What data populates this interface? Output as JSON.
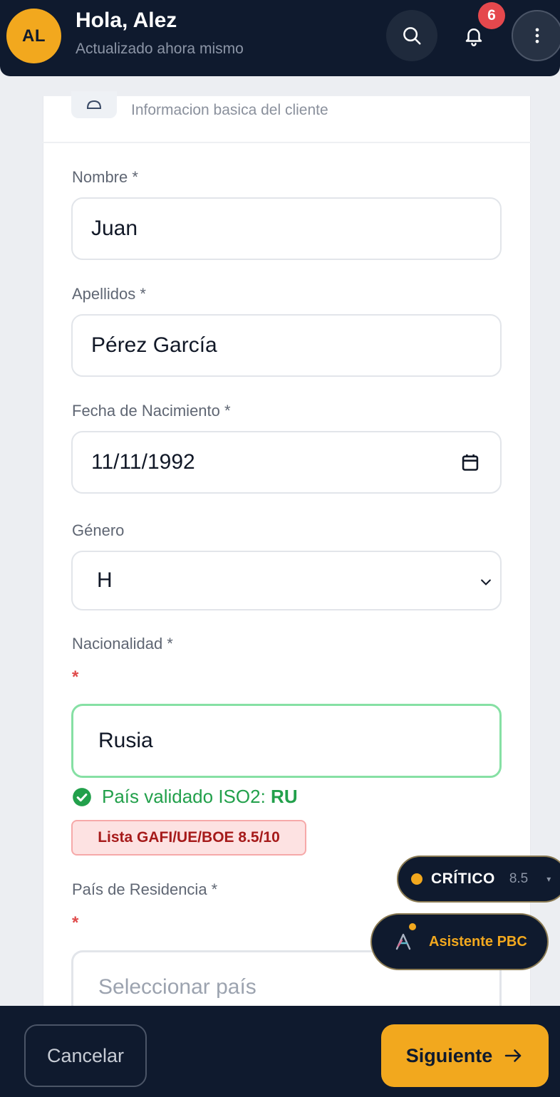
{
  "header": {
    "avatar_initials": "AL",
    "greeting": "Hola, Alez",
    "subtitle": "Actualizado ahora mismo",
    "notification_count": "6",
    "icons": [
      "search-icon",
      "bell-icon",
      "more-vertical-icon"
    ]
  },
  "section": {
    "subtitle": "Informacion basica del cliente",
    "icon": "user-icon"
  },
  "form": {
    "nombre": {
      "label": "Nombre *",
      "value": "Juan"
    },
    "apellidos": {
      "label": "Apellidos *",
      "value": "Pérez García"
    },
    "fecha": {
      "label": "Fecha de Nacimiento *",
      "value": "11/11/1992",
      "icon": "calendar-icon"
    },
    "genero": {
      "label": "Género",
      "value": "H"
    },
    "nacionalidad": {
      "label": "Nacionalidad *",
      "required_mark": "*",
      "value": "Rusia",
      "validation_text": "País validado ISO2:",
      "iso_code": "RU",
      "risk_tag": "Lista GAFI/UE/BOE 8.5/10"
    },
    "residencia": {
      "label": "País de Residencia *",
      "required_mark": "*",
      "placeholder": "Seleccionar país"
    }
  },
  "floating": {
    "risk_level": "CRÍTICO",
    "risk_score": "8.5",
    "assistant_label": "Asistente PBC"
  },
  "footer": {
    "cancel_label": "Cancelar",
    "next_label": "Siguiente"
  },
  "colors": {
    "navy": "#0f1a2e",
    "accent": "#f2a81e",
    "success": "#22a04b",
    "danger": "#e04b4b"
  }
}
